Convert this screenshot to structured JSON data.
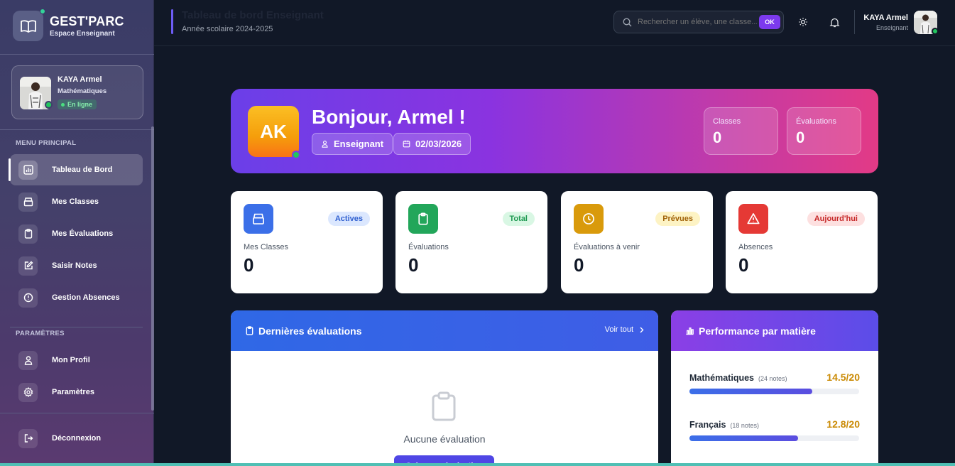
{
  "brand": {
    "title": "GEST'PARC",
    "subtitle": "Espace Enseignant"
  },
  "user_card": {
    "name": "KAYA Armel",
    "subject": "Mathématiques",
    "status": "En ligne"
  },
  "sidebar": {
    "section_main": "MENU PRINCIPAL",
    "main_items": [
      {
        "label": "Tableau de Bord",
        "icon": "bar-chart-icon",
        "active": true
      },
      {
        "label": "Mes Classes",
        "icon": "stack-icon"
      },
      {
        "label": "Mes Évaluations",
        "icon": "clipboard-icon"
      },
      {
        "label": "Saisir Notes",
        "icon": "edit-icon"
      },
      {
        "label": "Gestion Absences",
        "icon": "alert-circle-icon"
      }
    ],
    "section_settings": "PARAMÈTRES",
    "settings_items": [
      {
        "label": "Mon Profil",
        "icon": "user-icon"
      },
      {
        "label": "Paramètres",
        "icon": "gear-icon"
      }
    ],
    "logout": "Déconnexion"
  },
  "topbar": {
    "title": "Tableau de bord Enseignant",
    "subtitle": "Année scolaire 2024-2025",
    "search_placeholder": "Rechercher un élève, une classe...",
    "search_button": "OK",
    "user_name": "KAYA Armel",
    "user_role": "Enseignant"
  },
  "hero": {
    "initials": "AK",
    "greeting": "Bonjour, Armel !",
    "role_chip": "Enseignant",
    "date_chip": "02/03/2026",
    "stats": [
      {
        "label": "Classes",
        "value": "0"
      },
      {
        "label": "Évaluations",
        "value": "0"
      }
    ]
  },
  "cards": [
    {
      "label": "Mes Classes",
      "value": "0",
      "badge": "Actives",
      "color": "#3b6fe8"
    },
    {
      "label": "Évaluations",
      "value": "0",
      "badge": "Total",
      "color": "#22a65a"
    },
    {
      "label": "Évaluations à venir",
      "value": "0",
      "badge": "Prévues",
      "color": "#d99a0b"
    },
    {
      "label": "Absences",
      "value": "0",
      "badge": "Aujourd'hui",
      "color": "#e53935"
    }
  ],
  "evaluations_panel": {
    "title": "Dernières évaluations",
    "link": "Voir tout",
    "empty_text": "Aucune évaluation",
    "empty_button": "Créer une évaluation"
  },
  "performance_panel": {
    "title": "Performance par matière",
    "subjects": [
      {
        "name": "Mathématiques",
        "count": "(24 notes)",
        "score": "14.5/20",
        "fraction": 0.725
      },
      {
        "name": "Français",
        "count": "(18 notes)",
        "score": "12.8/20",
        "fraction": 0.64
      }
    ]
  }
}
